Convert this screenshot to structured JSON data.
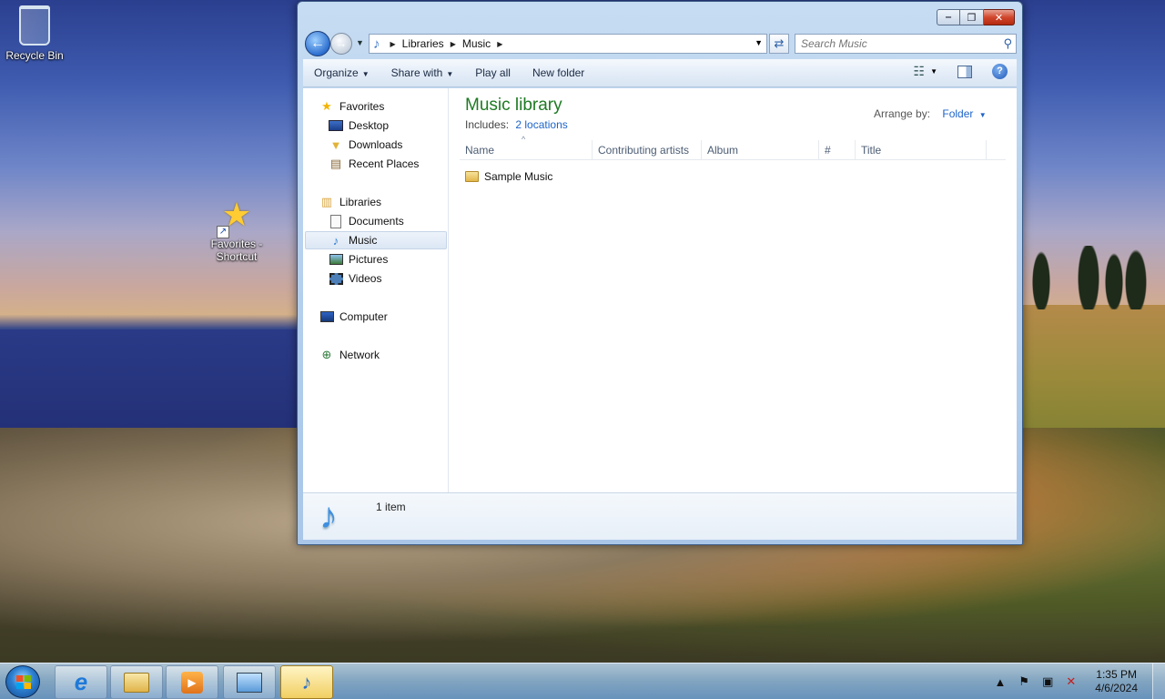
{
  "desktop": {
    "icons": [
      {
        "label": "Recycle Bin"
      },
      {
        "label": "Favorites - Shortcut"
      }
    ]
  },
  "window": {
    "caption": {
      "minimize": "‒",
      "maximize": "❐",
      "close": "✕"
    },
    "address": {
      "crumbs": [
        "Libraries",
        "Music"
      ]
    },
    "search": {
      "placeholder": "Search Music"
    },
    "toolbar": {
      "organize": "Organize",
      "share_with": "Share with",
      "play_all": "Play all",
      "new_folder": "New folder"
    },
    "navpane": {
      "favorites": "Favorites",
      "desktop": "Desktop",
      "downloads": "Downloads",
      "recent_places": "Recent Places",
      "libraries": "Libraries",
      "documents": "Documents",
      "music": "Music",
      "pictures": "Pictures",
      "videos": "Videos",
      "computer": "Computer",
      "network": "Network"
    },
    "library": {
      "title": "Music library",
      "includes_label": "Includes:",
      "includes_link": "2 locations",
      "arrange_label": "Arrange by:",
      "arrange_value": "Folder"
    },
    "columns": [
      "Name",
      "Contributing artists",
      "Album",
      "#",
      "Title"
    ],
    "files": [
      {
        "name": "Sample Music"
      }
    ],
    "details": {
      "count": "1 item"
    }
  },
  "taskbar": {
    "clock": {
      "time": "1:35 PM",
      "date": "4/6/2024"
    },
    "pinned": [
      "internet-explorer",
      "windows-explorer",
      "windows-media-player",
      "control-panel",
      "libraries"
    ]
  }
}
